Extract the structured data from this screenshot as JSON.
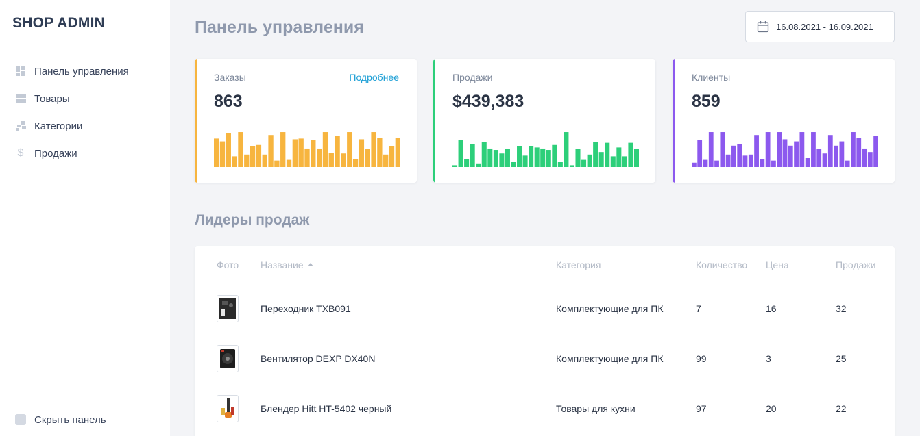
{
  "sidebar": {
    "brand": "SHOP ADMIN",
    "items": [
      {
        "label": "Панель управления",
        "icon": "dashboard-icon"
      },
      {
        "label": "Товары",
        "icon": "products-icon"
      },
      {
        "label": "Категории",
        "icon": "categories-icon"
      },
      {
        "label": "Продажи",
        "icon": "dollar-icon"
      }
    ],
    "collapse_label": "Скрыть панель"
  },
  "header": {
    "title": "Панель управления",
    "date_range": "16.08.2021 - 16.09.2021"
  },
  "colors": {
    "orders": "#f7b53f",
    "sales": "#2dcf7a",
    "clients": "#8c59ee",
    "link": "#1fa0d6"
  },
  "cards": [
    {
      "label": "Заказы",
      "value": "863",
      "link": "Подробнее",
      "color": "#f7b53f",
      "bars": [
        0.8,
        0.72,
        0.95,
        0.3,
        0.98,
        0.35,
        0.58,
        0.62,
        0.35,
        0.9,
        0.18,
        0.98,
        0.2,
        0.78,
        0.8,
        0.52,
        0.75,
        0.52,
        0.98,
        0.4,
        0.88,
        0.38,
        0.98,
        0.22,
        0.78,
        0.5,
        0.98,
        0.82,
        0.35,
        0.58,
        0.82
      ]
    },
    {
      "label": "Продажи",
      "value": "$439,383",
      "color": "#2dcf7a",
      "bars": [
        0.05,
        0.75,
        0.22,
        0.65,
        0.1,
        0.7,
        0.52,
        0.48,
        0.38,
        0.5,
        0.15,
        0.58,
        0.32,
        0.58,
        0.55,
        0.52,
        0.48,
        0.62,
        0.15,
        0.98,
        0.05,
        0.5,
        0.2,
        0.35,
        0.7,
        0.42,
        0.68,
        0.3,
        0.55,
        0.3,
        0.68,
        0.5
      ]
    },
    {
      "label": "Клиенты",
      "value": "859",
      "color": "#8c59ee",
      "bars": [
        0.12,
        0.75,
        0.2,
        0.98,
        0.18,
        0.98,
        0.35,
        0.6,
        0.65,
        0.32,
        0.35,
        0.9,
        0.22,
        0.98,
        0.18,
        0.98,
        0.78,
        0.6,
        0.72,
        0.98,
        0.25,
        0.98,
        0.5,
        0.38,
        0.9,
        0.6,
        0.72,
        0.18,
        0.98,
        0.82,
        0.52,
        0.42,
        0.88
      ]
    }
  ],
  "section_title": "Лидеры продаж",
  "table": {
    "headers": {
      "photo": "Фото",
      "name": "Название",
      "category": "Категория",
      "quantity": "Количество",
      "price": "Цена",
      "sales": "Продажи"
    },
    "rows": [
      {
        "name": "Переходник TXB091",
        "category": "Комплектующие для ПК",
        "quantity": "7",
        "price": "16",
        "sales": "32",
        "thumb": "adapter-image"
      },
      {
        "name": "Вентилятор DEXP DX40N",
        "category": "Комплектующие для ПК",
        "quantity": "99",
        "price": "3",
        "sales": "25",
        "thumb": "fan-image"
      },
      {
        "name": "Блендер Hitt HT-5402 черный",
        "category": "Товары для кухни",
        "quantity": "97",
        "price": "20",
        "sales": "22",
        "thumb": "blender-image"
      }
    ]
  }
}
